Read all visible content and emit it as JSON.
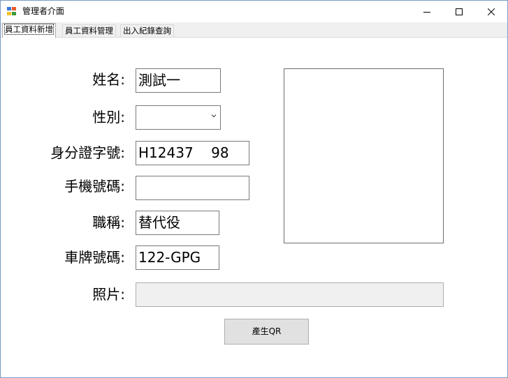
{
  "window": {
    "title": "管理者介面",
    "controls": {
      "minimize": "—",
      "maximize": "☐",
      "close": "✕"
    }
  },
  "tabs": [
    {
      "label": "員工資料新增",
      "active": true
    },
    {
      "label": "員工資料管理",
      "active": false
    },
    {
      "label": "出入紀錄查詢",
      "active": false
    }
  ],
  "form": {
    "name_label": "姓名:",
    "name_value": "測試一",
    "gender_label": "性別:",
    "gender_value": "",
    "id_label": "身分證字號:",
    "id_value": "H12437    98",
    "phone_label": "手機號碼:",
    "phone_value": "",
    "title_label": "職稱:",
    "title_value": "替代役",
    "plate_label": "車牌號碼:",
    "plate_value": "122-GPG",
    "photo_label": "照片:",
    "photo_value": ""
  },
  "buttons": {
    "generate_qr": "產生QR"
  }
}
